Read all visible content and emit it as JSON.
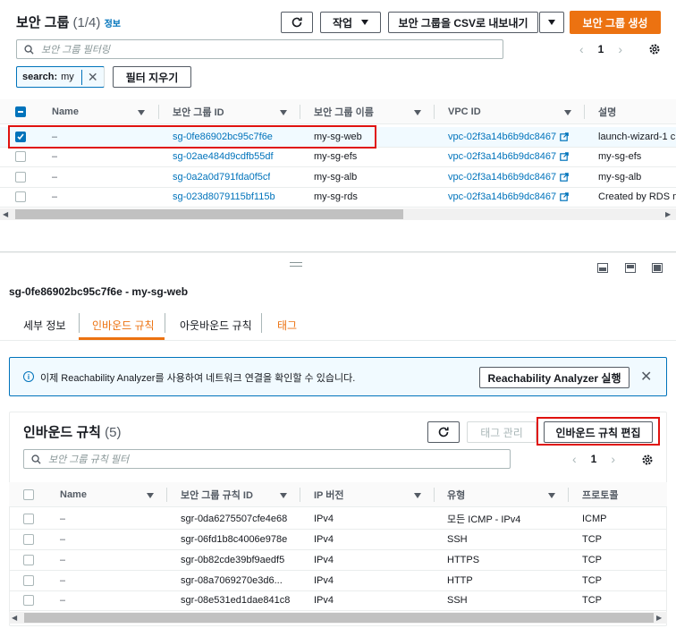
{
  "top": {
    "title": "보안 그룹",
    "count": "(1/4)",
    "info": "정보",
    "actions_label": "작업",
    "export_label": "보안 그룹을 CSV로 내보내기",
    "create_label": "보안 그룹 생성",
    "filter_placeholder": "보안 그룹 필터링",
    "token_key": "search:",
    "token_value": "my",
    "clear_filters": "필터 지우기",
    "page": "1",
    "columns": [
      "Name",
      "보안 그룹 ID",
      "보안 그룹 이름",
      "VPC ID",
      "설명"
    ],
    "rows": [
      {
        "name": "–",
        "id": "sg-0fe86902bc95c7f6e",
        "gname": "my-sg-web",
        "vpc": "vpc-02f3a14b6b9dc8467",
        "desc": "launch-wizard-1 c",
        "selected": true
      },
      {
        "name": "–",
        "id": "sg-02ae484d9cdfb55df",
        "gname": "my-sg-efs",
        "vpc": "vpc-02f3a14b6b9dc8467",
        "desc": "my-sg-efs",
        "selected": false
      },
      {
        "name": "–",
        "id": "sg-0a2a0d791fda0f5cf",
        "gname": "my-sg-alb",
        "vpc": "vpc-02f3a14b6b9dc8467",
        "desc": "my-sg-alb",
        "selected": false
      },
      {
        "name": "–",
        "id": "sg-023d8079115bf115b",
        "gname": "my-sg-rds",
        "vpc": "vpc-02f3a14b6b9dc8467",
        "desc": "Created by RDS m",
        "selected": false
      }
    ]
  },
  "detail": {
    "title": "sg-0fe86902bc95c7f6e - my-sg-web",
    "tabs": [
      "세부 정보",
      "인바운드 규칙",
      "아웃바운드 규칙",
      "태그"
    ],
    "banner_text": "이제 Reachability Analyzer를 사용하여 네트워크 연결을 확인할 수 있습니다.",
    "banner_button": "Reachability Analyzer 실행"
  },
  "inbound": {
    "title": "인바운드 규칙",
    "count": "(5)",
    "manage_tags": "태그 관리",
    "edit_rules": "인바운드 규칙 편집",
    "filter_placeholder": "보안 그룹 규칙 필터",
    "page": "1",
    "columns": [
      "Name",
      "보안 그룹 규칙 ID",
      "IP 버전",
      "유형",
      "프로토콜"
    ],
    "rows": [
      {
        "name": "–",
        "id": "sgr-0da6275507cfe4e68",
        "ip": "IPv4",
        "type": "모든 ICMP - IPv4",
        "proto": "ICMP"
      },
      {
        "name": "–",
        "id": "sgr-06fd1b8c4006e978e",
        "ip": "IPv4",
        "type": "SSH",
        "proto": "TCP"
      },
      {
        "name": "–",
        "id": "sgr-0b82cde39bf9aedf5",
        "ip": "IPv4",
        "type": "HTTPS",
        "proto": "TCP"
      },
      {
        "name": "–",
        "id": "sgr-08a7069270e3d6...",
        "ip": "IPv4",
        "type": "HTTP",
        "proto": "TCP"
      },
      {
        "name": "–",
        "id": "sgr-08e531ed1dae841c8",
        "ip": "IPv4",
        "type": "SSH",
        "proto": "TCP"
      }
    ]
  },
  "colors": {
    "accent": "#ec7211",
    "link": "#0073bb",
    "highlight": "#e0120f"
  }
}
